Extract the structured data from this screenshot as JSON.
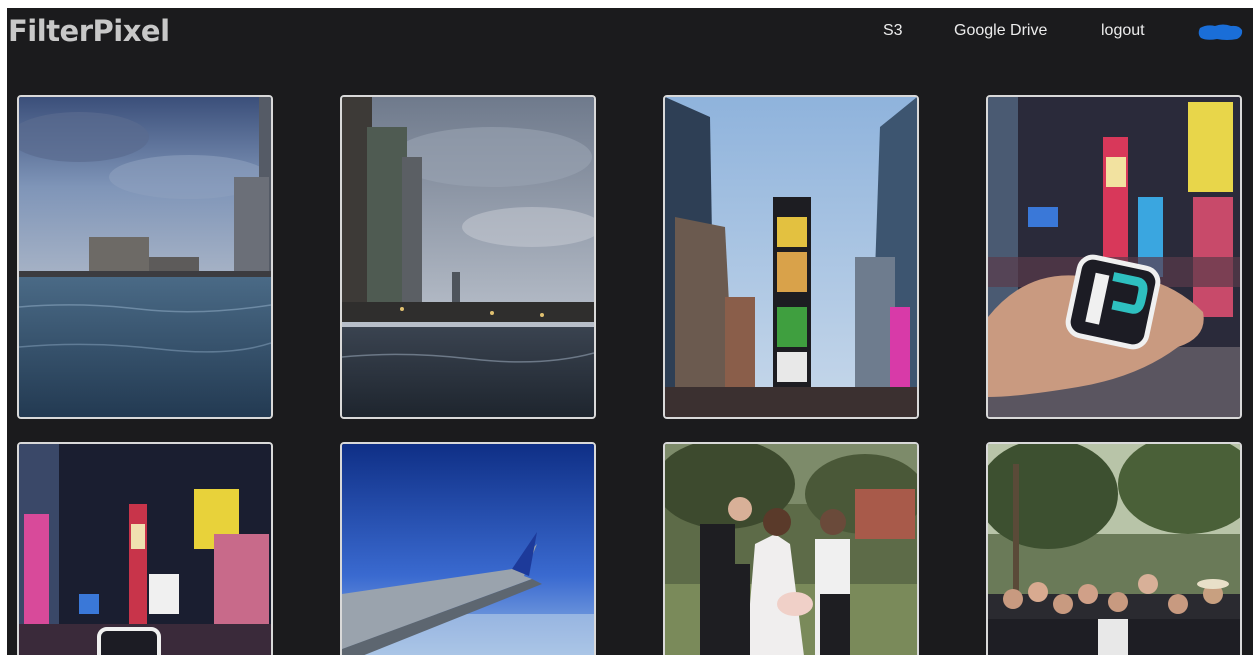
{
  "navbar": {
    "brand": "FilterPixel",
    "links": [
      "S3",
      "Google Drive",
      "logout"
    ],
    "avatar_color": "#1a6ed8"
  },
  "photos": [
    {
      "subject": "Harbor under cloudy dusk sky"
    },
    {
      "subject": "Waterfront skyline with clouds"
    },
    {
      "subject": "Times Square towers daytime"
    },
    {
      "subject": "Hand holding FilterPixel sticker in Times Square"
    },
    {
      "subject": "Times Square at night"
    },
    {
      "subject": "Airplane wing above clouds"
    },
    {
      "subject": "Wedding party portrait in garden"
    },
    {
      "subject": "Family group photo outdoors"
    }
  ],
  "colors": {
    "background": "#1b1b1d",
    "card_border": "#d9d9d9",
    "text": "#ececec",
    "brand": "#c8c8c8"
  }
}
